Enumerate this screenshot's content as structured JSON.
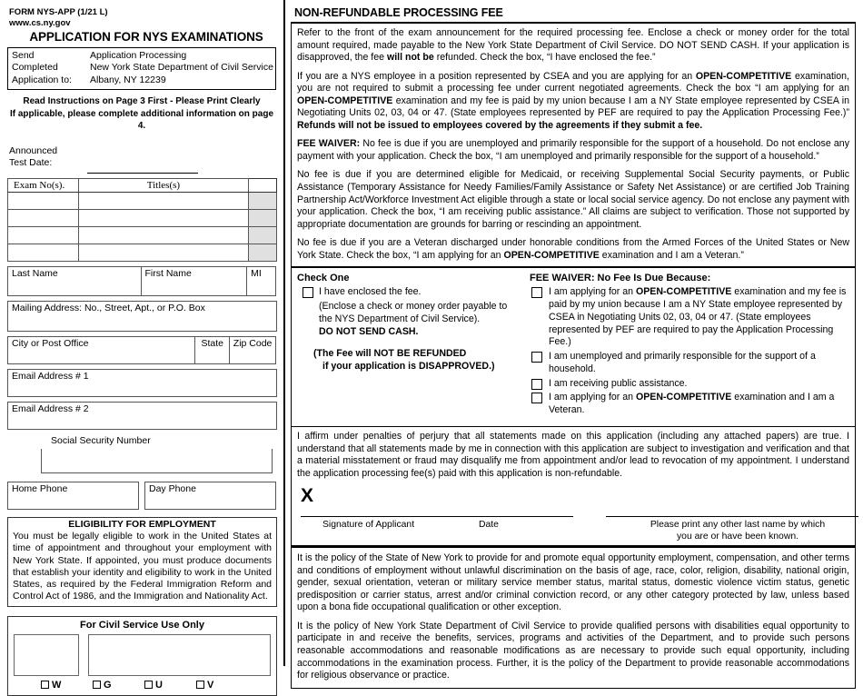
{
  "left": {
    "form_id": "FORM NYS-APP (1/21 L)",
    "website": "www.cs.ny.gov",
    "title": "APPLICATION FOR NYS EXAMINATIONS",
    "send_box": [
      {
        "label": "Send",
        "value": "Application Processing"
      },
      {
        "label": "Completed",
        "value": "New York State Department of Civil Service"
      },
      {
        "label": "Application to:",
        "value": "Albany, NY 12239"
      }
    ],
    "instructions_line1": "Read Instructions on Page 3 First - Please Print Clearly",
    "instructions_line2": "If applicable, please complete additional information on page 4.",
    "announced_line1": "Announced",
    "announced_line2": "Test Date:",
    "exam_table": {
      "headers": [
        "Exam No(s).",
        "Titles(s)"
      ],
      "row_count": 4
    },
    "name_fields": [
      {
        "label": "Last Name"
      },
      {
        "label": "First Name"
      },
      {
        "label": "MI"
      }
    ],
    "mailing_label": "Mailing Address:  No., Street, Apt., or P.O. Box",
    "city_fields": [
      {
        "label": "City or Post Office"
      },
      {
        "label": "State"
      },
      {
        "label": "Zip Code"
      }
    ],
    "email1_label": "Email Address # 1",
    "email2_label": "Email Address # 2",
    "ssn_label": "Social Security Number",
    "phone_fields": [
      {
        "label": "Home Phone"
      },
      {
        "label": "Day Phone"
      }
    ],
    "eligibility": {
      "title": "ELIGIBILITY FOR EMPLOYMENT",
      "body": "You must be legally eligible to work in the United States at time of appointment and throughout your employment with New York State.  If appointed, you must produce documents that establish your identity and eligibility to work in the United States, as required by the Federal Immigration Reform and Control Act of 1986, and the Immigration and Nationality Act."
    },
    "civil_service": {
      "title": "For Civil Service Use Only",
      "checkboxes": [
        "W",
        "G",
        "U",
        "V"
      ]
    }
  },
  "right": {
    "section_title": "NON-REFUNDABLE PROCESSING FEE",
    "fee_paragraphs": [
      {
        "parts": [
          {
            "t": "Refer to the front of the exam announcement for the required processing fee.  Enclose a check or money order for the total amount required, made payable to the New York State Department of Civil Service.  DO NOT SEND CASH.  If your application is disapproved, the fee ",
            "b": false
          },
          {
            "t": "will not be",
            "b": true
          },
          {
            "t": " refunded.  Check the box, “I have enclosed the fee.”",
            "b": false
          }
        ]
      },
      {
        "parts": [
          {
            "t": "If you are a NYS employee in a position represented by CSEA and you are applying for an ",
            "b": false
          },
          {
            "t": "OPEN-COMPETITIVE",
            "b": true
          },
          {
            "t": " examination, you are not required to submit a processing fee under current negotiated agreements.  Check the box “I am applying for an ",
            "b": false
          },
          {
            "t": "OPEN-COMPETITIVE",
            "b": true
          },
          {
            "t": " examination and my fee is paid by my union because I am a NY State employee represented by CSEA in Negotiating Units 02, 03, 04 or 47.  (State employees represented by PEF are required to pay the Application Processing Fee.)” ",
            "b": false
          },
          {
            "t": "Refunds will not be issued to employees covered by the agreements if they submit a fee.",
            "b": true
          }
        ]
      },
      {
        "parts": [
          {
            "t": "FEE WAIVER:",
            "b": true
          },
          {
            "t": " No fee is due if you are unemployed and primarily responsible for the support of a household.  Do not enclose any payment with your application.  Check the box, “I am unemployed and primarily responsible for the support of a household.”",
            "b": false
          }
        ]
      },
      {
        "parts": [
          {
            "t": "No fee is due if you are determined eligible for Medicaid, or receiving Supplemental Social Security payments, or Public Assistance (Temporary Assistance for Needy Families/Family Assistance or Safety Net Assistance) or are certified Job Training Partnership Act/Workforce Investment Act eligible through a state or local social service agency.  Do not enclose any payment with your application.  Check the box, “I am receiving public assistance.” All claims are subject to verification.  Those not supported by appropriate documentation are grounds for barring or rescinding an appointment.",
            "b": false
          }
        ]
      },
      {
        "parts": [
          {
            "t": "No fee is due if you are a Veteran discharged under honorable conditions from the Armed Forces of the United States or New York State. Check the box, “I am applying for an ",
            "b": false
          },
          {
            "t": "OPEN-COMPETITIVE",
            "b": true
          },
          {
            "t": " examination and I am a Veteran.”",
            "b": false
          }
        ]
      }
    ],
    "check_one": {
      "title": "Check One",
      "option_main": "I have enclosed the fee.",
      "option_sub1": "(Enclose a check or money order payable to",
      "option_sub2": "the NYS Department of Civil Service).",
      "option_sub3": "DO NOT SEND CASH.",
      "refund_line1": "(The Fee will NOT BE REFUNDED",
      "refund_line2": "if your application is DISAPPROVED.)"
    },
    "fee_waiver_box": {
      "title": "FEE WAIVER: No Fee Is Due Because:",
      "options": [
        {
          "parts": [
            {
              "t": "I am applying for an ",
              "b": false
            },
            {
              "t": "OPEN-COMPETITIVE",
              "b": true
            },
            {
              "t": " examination and my fee is paid by my union because I am a NY State employee represented by CSEA in Negotiating Units 02, 03, 04 or 47.  (State employees represented by PEF are required to pay the Application Processing Fee.)",
              "b": false
            }
          ]
        },
        {
          "parts": [
            {
              "t": "I am unemployed and primarily responsible for the support of a household.",
              "b": false
            }
          ]
        },
        {
          "parts": [
            {
              "t": "I am receiving public assistance.",
              "b": false
            }
          ]
        },
        {
          "parts": [
            {
              "t": "I am applying for an ",
              "b": false
            },
            {
              "t": "OPEN-COMPETITIVE",
              "b": true
            },
            {
              "t": " examination and I am a Veteran.",
              "b": false
            }
          ]
        }
      ]
    },
    "affirmation": "I affirm under penalties of perjury that all statements made on this application (including any attached papers) are true.  I understand that all statements made by me in connection with this application are subject to investigation and verification and that a material misstatement or fraud may disqualify me from appointment and/or lead to revocation of my appointment. I understand the application processing fee(s) paid with this application is non-refundable.",
    "signature": {
      "x_mark": "X",
      "label_signature": "Signature of Applicant",
      "label_date": "Date",
      "label_other_line1": "Please print any other last name by which",
      "label_other_line2": "you are or have been known."
    },
    "policy_paragraphs": [
      "It is the policy of the State of New York to provide for and promote equal opportunity employment, compensation, and other terms and conditions of employment without unlawful discrimination on the basis of age, race, color, religion, disability, national origin, gender, sexual orientation, veteran or military service member status, marital status, domestic violence victim status, genetic predisposition or carrier status, arrest and/or criminal conviction record, or any other category protected by law, unless based upon a bona fide occupational qualification or other exception.",
      "It is the policy of New York State Department of Civil Service to provide qualified persons with disabilities equal opportunity to participate in and receive the benefits, services, programs and activities of the Department, and to provide such persons reasonable accommodations and reasonable modifications as are necessary to provide such equal opportunity, including accommodations in the examination process.  Further, it is the policy of the Department to provide reasonable accommodations for religious observance or practice."
    ]
  }
}
